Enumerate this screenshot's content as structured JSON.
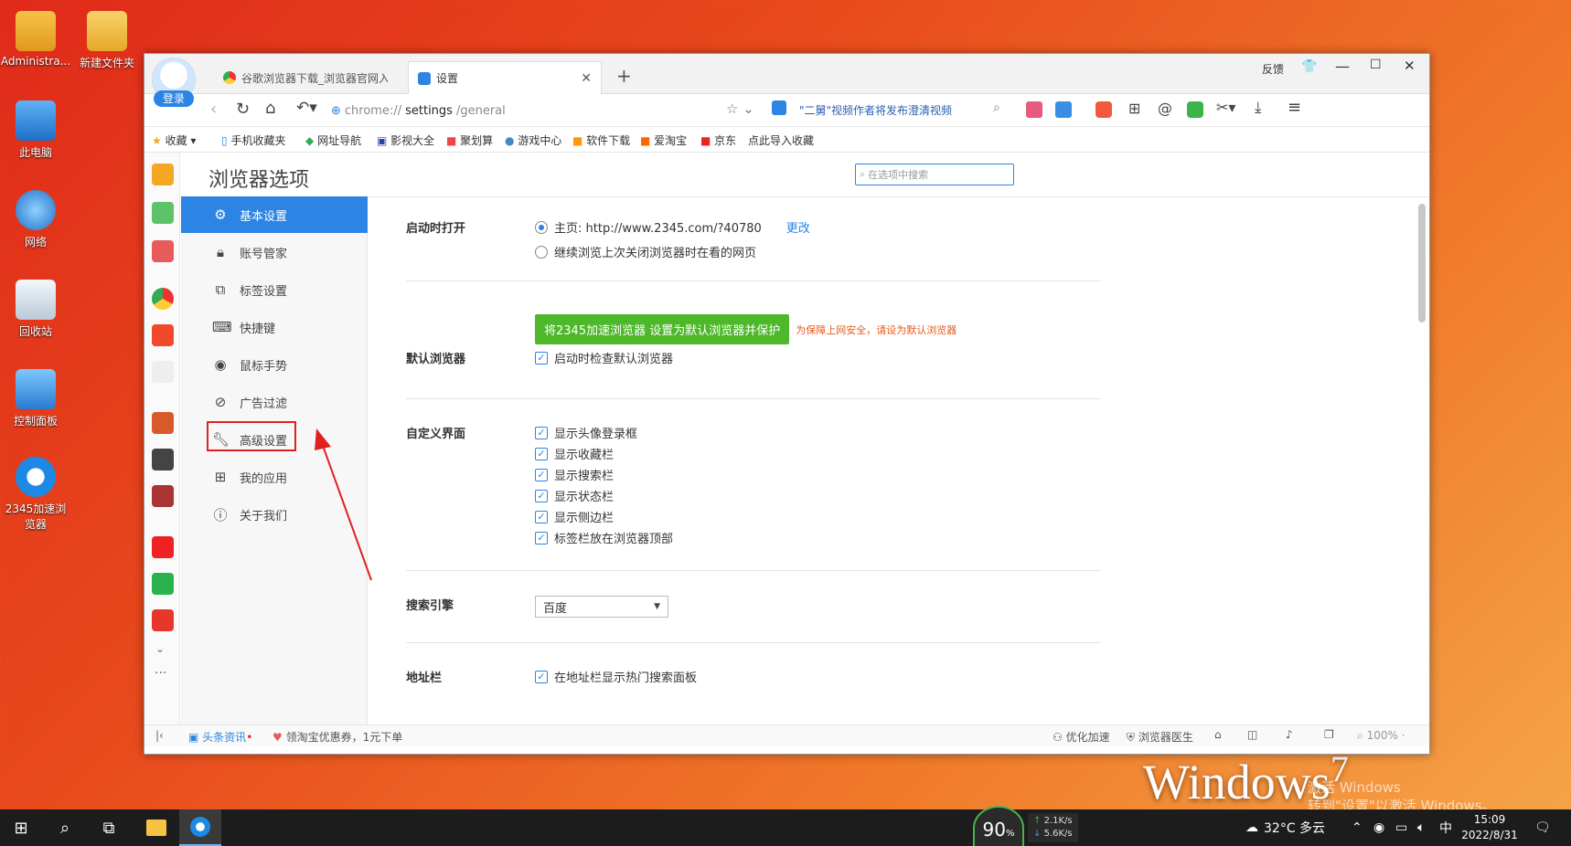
{
  "desktop": {
    "icons": [
      {
        "label": "Administra...",
        "icon": "user-folder-icon"
      },
      {
        "label": "新建文件夹",
        "icon": "folder-icon"
      },
      {
        "label": "此电脑",
        "icon": "computer-icon"
      },
      {
        "label": "网络",
        "icon": "network-icon"
      },
      {
        "label": "回收站",
        "icon": "recycle-bin-icon"
      },
      {
        "label": "控制面板",
        "icon": "control-panel-icon"
      },
      {
        "label": "2345加速浏览器",
        "icon": "browser-icon"
      }
    ],
    "watermark": {
      "brand": "Windows",
      "version": "7",
      "activate_line1": "激活 Windows",
      "activate_line2": "转到\"设置\"以激活 Windows。"
    }
  },
  "browser": {
    "login_label": "登录",
    "tabs": [
      {
        "label": "谷歌浏览器下载_浏览器官网入",
        "active": false
      },
      {
        "label": "设置",
        "active": true
      }
    ],
    "window_controls": {
      "feedback": "反馈"
    },
    "address": {
      "scheme": "chrome://",
      "path": "settings",
      "rest": "/general"
    },
    "news_ticker": "\"二舅\"视频作者将发布澄清视频",
    "bookmarks": [
      "收藏",
      "手机收藏夹",
      "网址导航",
      "影视大全",
      "聚划算",
      "游戏中心",
      "软件下载",
      "爱淘宝",
      "京东",
      "点此导入收藏"
    ],
    "settings": {
      "title": "浏览器选项",
      "search_placeholder": "在选项中搜索",
      "nav": [
        {
          "label": "基本设置",
          "icon": "gear-icon",
          "active": true
        },
        {
          "label": "账号管家",
          "icon": "lock-icon",
          "active": false
        },
        {
          "label": "标签设置",
          "icon": "tabs-icon",
          "active": false
        },
        {
          "label": "快捷键",
          "icon": "keyboard-icon",
          "active": false
        },
        {
          "label": "鼠标手势",
          "icon": "mouse-icon",
          "active": false
        },
        {
          "label": "广告过滤",
          "icon": "block-icon",
          "active": false
        },
        {
          "label": "高级设置",
          "icon": "wrench-icon",
          "active": false
        },
        {
          "label": "我的应用",
          "icon": "apps-icon",
          "active": false
        },
        {
          "label": "关于我们",
          "icon": "info-icon",
          "active": false
        }
      ],
      "startup": {
        "label": "启动时打开",
        "homepage": "主页: http://www.2345.com/?40780",
        "change": "更改",
        "continue": "继续浏览上次关闭浏览器时在看的网页"
      },
      "default_browser": {
        "label": "默认浏览器",
        "button": "将2345加速浏览器 设置为默认浏览器并保护",
        "hint": "为保障上网安全，请设为默认浏览器",
        "check": "启动时检查默认浏览器"
      },
      "custom_ui": {
        "label": "自定义界面",
        "options": [
          "显示头像登录框",
          "显示收藏栏",
          "显示搜索栏",
          "显示状态栏",
          "显示侧边栏",
          "标签栏放在浏览器顶部"
        ]
      },
      "search_engine": {
        "label": "搜索引擎",
        "value": "百度"
      },
      "address_bar": {
        "label": "地址栏",
        "option": "在地址栏显示热门搜索面板"
      }
    },
    "statusbar": {
      "news": "头条资讯",
      "promo": "领淘宝优惠券，1元下单",
      "optimize": "优化加速",
      "doctor": "浏览器医生",
      "zoom": "100%"
    }
  },
  "taskbar": {
    "cpu": "90",
    "cpu_unit": "%",
    "net_up": "2.1",
    "net_down": "5.6",
    "net_unit": "K/s",
    "weather": "32°C 多云",
    "ime": "中",
    "time": "15:09",
    "date": "2022/8/31"
  }
}
